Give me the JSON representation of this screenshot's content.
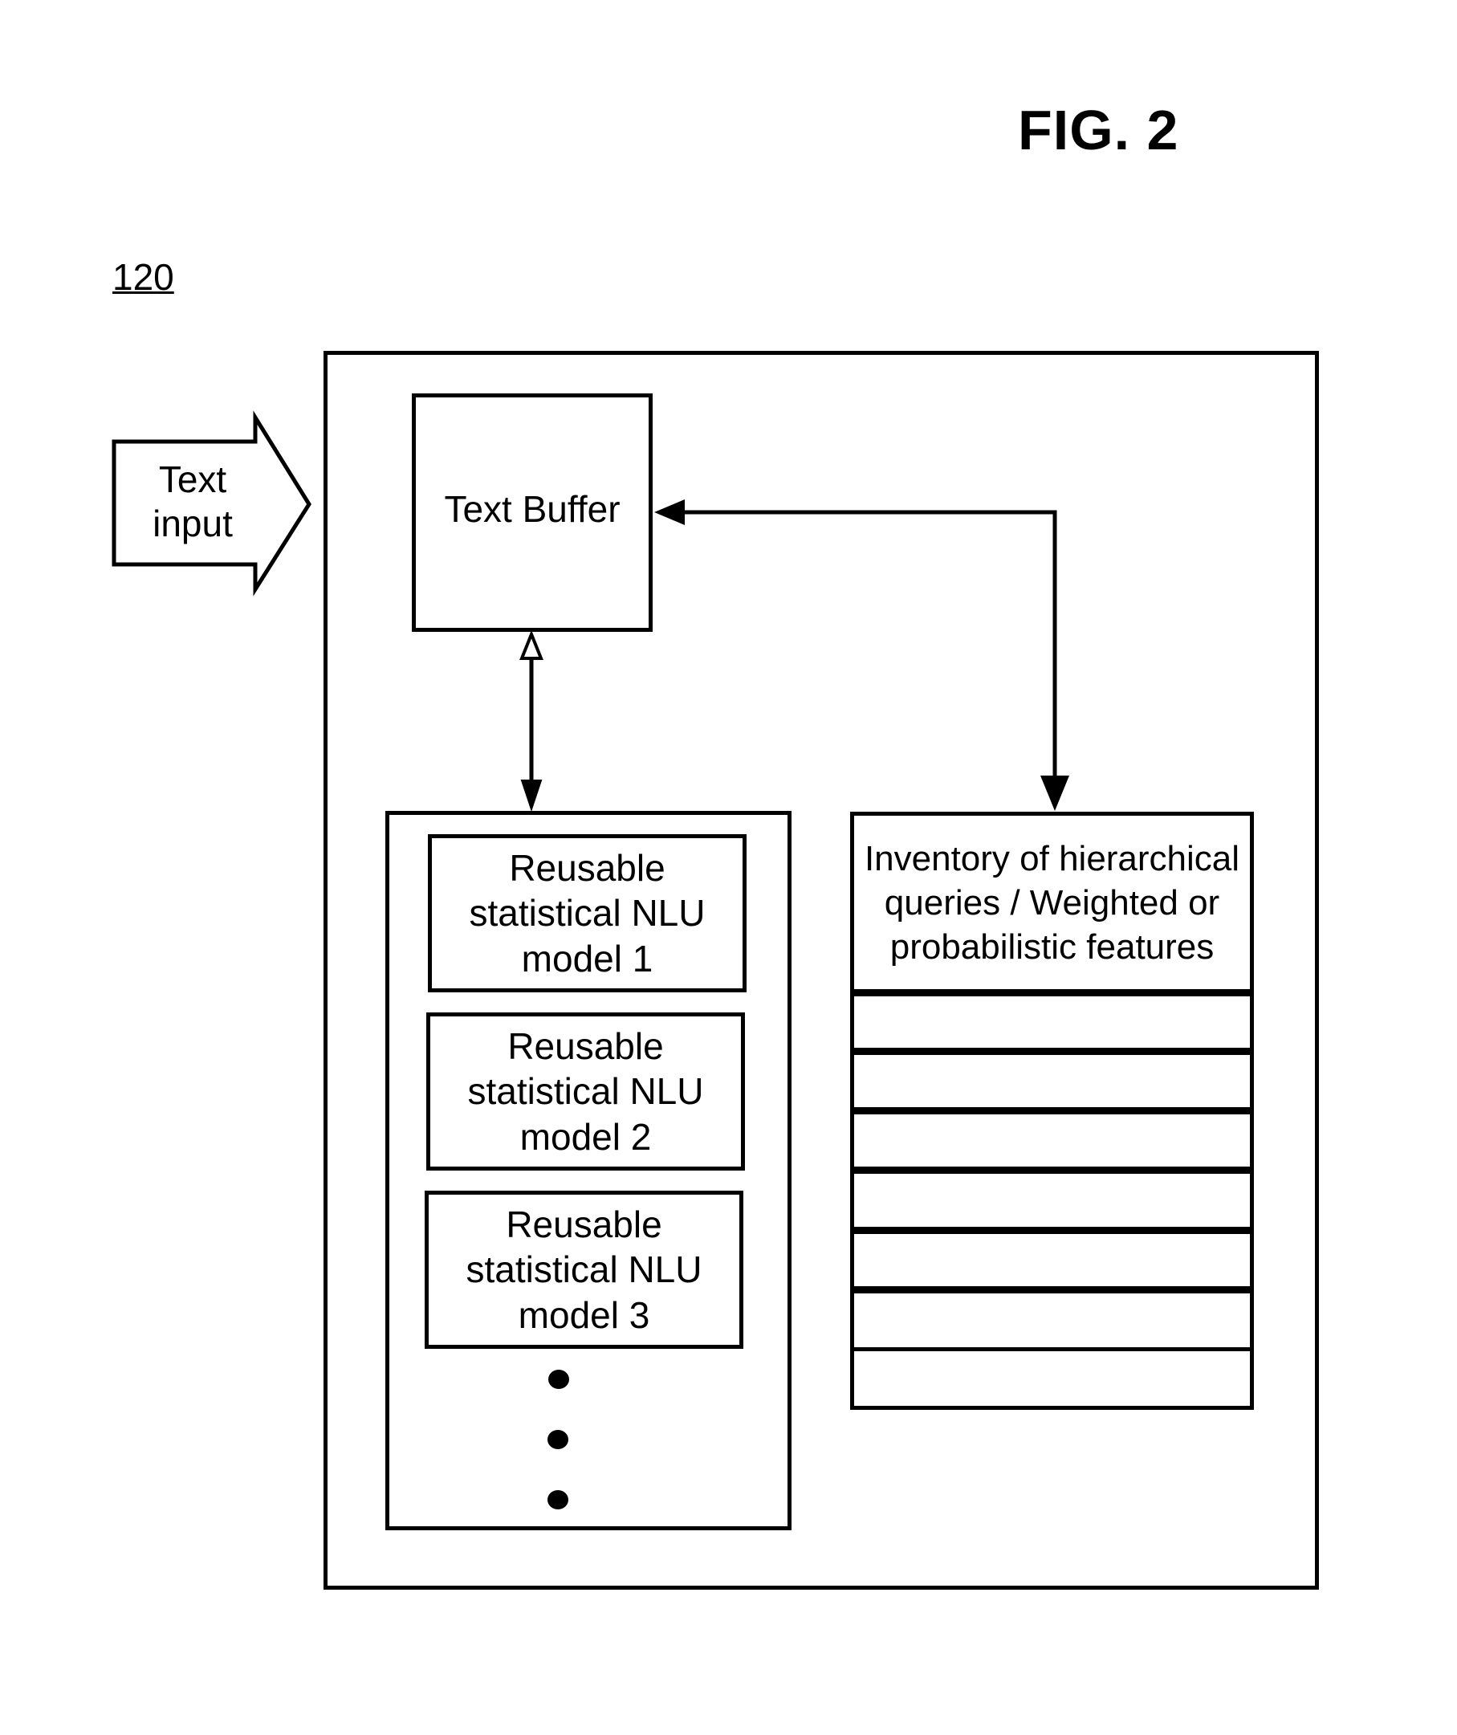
{
  "figure": {
    "title": "FIG. 2",
    "reference_number": "120"
  },
  "input_arrow": {
    "line1": "Text",
    "line2": "input"
  },
  "text_buffer": {
    "label": "Text Buffer"
  },
  "models": [
    {
      "line1": "Reusable",
      "line2": "statistical NLU",
      "line3": "model 1"
    },
    {
      "line1": "Reusable",
      "line2": "statistical NLU",
      "line3": "model 2"
    },
    {
      "line1": "Reusable",
      "line2": "statistical NLU",
      "line3": "model 3"
    }
  ],
  "models_continuation": "vertical ellipsis (3 dots)",
  "inventory": {
    "line1": "Inventory of hierarchical",
    "line2": "queries / Weighted or",
    "line3": "probabilistic features",
    "empty_rows": 7
  },
  "connections": [
    {
      "from": "text_buffer",
      "to": "models",
      "type": "bidirectional"
    },
    {
      "from": "text_buffer",
      "to": "inventory",
      "type": "bidirectional"
    },
    {
      "from": "input_arrow",
      "to": "outer_system",
      "type": "input"
    }
  ]
}
